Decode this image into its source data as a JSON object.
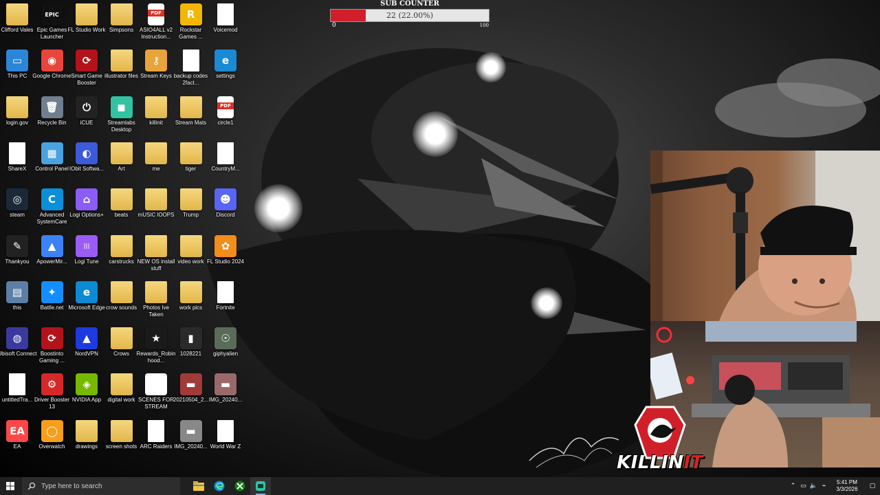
{
  "desktop": {
    "icons": [
      {
        "label": "Clifford Vales",
        "glyph": "",
        "kind": "folder",
        "color": "#e2b64a"
      },
      {
        "label": "Epic Games Launcher",
        "glyph": "EPIC",
        "kind": "app",
        "color": "#111111"
      },
      {
        "label": "FL Studio Work",
        "glyph": "",
        "kind": "folder",
        "color": "#e2b64a"
      },
      {
        "label": "Simpsons",
        "glyph": "",
        "kind": "folder",
        "color": "#e2b64a"
      },
      {
        "label": "ASIO4ALL v2 Instruction...",
        "glyph": "",
        "kind": "pdf",
        "color": "#d93025"
      },
      {
        "label": "Rockstar Games ...",
        "glyph": "R",
        "kind": "app",
        "color": "#f2b705"
      },
      {
        "label": "Voicemod",
        "glyph": "",
        "kind": "file",
        "color": "#ffffff"
      },
      {
        "label": "This PC",
        "glyph": "▭",
        "kind": "app",
        "color": "#2b86d9"
      },
      {
        "label": "Google Chrome",
        "glyph": "◉",
        "kind": "app",
        "color": "#e8453c"
      },
      {
        "label": "Smart Game Booster",
        "glyph": "⟳",
        "kind": "app",
        "color": "#b3121a"
      },
      {
        "label": "illustrator files",
        "glyph": "",
        "kind": "folder",
        "color": "#e2b64a"
      },
      {
        "label": "Stream Keys",
        "glyph": "⚷",
        "kind": "app",
        "color": "#e8a33a"
      },
      {
        "label": "backup codes 2fact...",
        "glyph": "",
        "kind": "file",
        "color": "#ffffff"
      },
      {
        "label": "settings",
        "glyph": "e",
        "kind": "app",
        "color": "#1a8ad4"
      },
      {
        "label": "login.gov",
        "glyph": "",
        "kind": "folder",
        "color": "#e2b64a"
      },
      {
        "label": "Recycle Bin",
        "glyph": "🗑",
        "kind": "app",
        "color": "#6f7f8f"
      },
      {
        "label": "iCUE",
        "glyph": "⏻",
        "kind": "app",
        "color": "#222222"
      },
      {
        "label": "Streamlabs Desktop",
        "glyph": "◼",
        "kind": "app",
        "color": "#31c3a2"
      },
      {
        "label": "killinit",
        "glyph": "",
        "kind": "folder",
        "color": "#e2b64a"
      },
      {
        "label": "Stream Mats",
        "glyph": "",
        "kind": "folder",
        "color": "#e2b64a"
      },
      {
        "label": "circle1",
        "glyph": "",
        "kind": "pdf",
        "color": "#d93025"
      },
      {
        "label": "ShareX",
        "glyph": "",
        "kind": "file",
        "color": "#ffffff"
      },
      {
        "label": "Control Panel",
        "glyph": "▦",
        "kind": "app",
        "color": "#4aa3df"
      },
      {
        "label": "IObit Softwa...",
        "glyph": "◐",
        "kind": "app",
        "color": "#3d5ad8"
      },
      {
        "label": "Art",
        "glyph": "",
        "kind": "folder",
        "color": "#e2b64a"
      },
      {
        "label": "me",
        "glyph": "",
        "kind": "folder",
        "color": "#e2b64a"
      },
      {
        "label": "tiger",
        "glyph": "",
        "kind": "folder",
        "color": "#e2b64a"
      },
      {
        "label": "CountryM...",
        "glyph": "",
        "kind": "file",
        "color": "#ffffff"
      },
      {
        "label": "steam",
        "glyph": "◎",
        "kind": "app",
        "color": "#1b2838"
      },
      {
        "label": "Advanced SystemCare",
        "glyph": "C",
        "kind": "app",
        "color": "#0a8fd9"
      },
      {
        "label": "Logi Options+",
        "glyph": "⌂",
        "kind": "app",
        "color": "#8b5cf6"
      },
      {
        "label": "beats",
        "glyph": "",
        "kind": "folder",
        "color": "#e2b64a"
      },
      {
        "label": "mUSIC lOOPS",
        "glyph": "",
        "kind": "folder",
        "color": "#e2b64a"
      },
      {
        "label": "Trump",
        "glyph": "",
        "kind": "folder",
        "color": "#e2b64a"
      },
      {
        "label": "Discord",
        "glyph": "☻",
        "kind": "app",
        "color": "#5865f2"
      },
      {
        "label": "Thankyou",
        "glyph": "✎",
        "kind": "app",
        "color": "#222222"
      },
      {
        "label": "ApowerMir...",
        "glyph": "▲",
        "kind": "app",
        "color": "#3b82f6"
      },
      {
        "label": "Logi Tune",
        "glyph": "|||",
        "kind": "app",
        "color": "#9b5cf6"
      },
      {
        "label": "carstrucks",
        "glyph": "",
        "kind": "folder",
        "color": "#e2b64a"
      },
      {
        "label": "NEW OS install stuff",
        "glyph": "",
        "kind": "folder",
        "color": "#e2b64a"
      },
      {
        "label": "video work",
        "glyph": "",
        "kind": "folder",
        "color": "#e2b64a"
      },
      {
        "label": "FL Studio 2024",
        "glyph": "✿",
        "kind": "app",
        "color": "#f28c1b"
      },
      {
        "label": "this",
        "glyph": "▤",
        "kind": "app",
        "color": "#5b7fa6"
      },
      {
        "label": "Battle.net",
        "glyph": "✦",
        "kind": "app",
        "color": "#148eff"
      },
      {
        "label": "Microsoft Edge",
        "glyph": "e",
        "kind": "app",
        "color": "#0c8ad3"
      },
      {
        "label": "crow sounds",
        "glyph": "",
        "kind": "folder",
        "color": "#e2b64a"
      },
      {
        "label": "Photos Ive Taken",
        "glyph": "",
        "kind": "folder",
        "color": "#e2b64a"
      },
      {
        "label": "work pics",
        "glyph": "",
        "kind": "folder",
        "color": "#e2b64a"
      },
      {
        "label": "Fortnite",
        "glyph": "",
        "kind": "file",
        "color": "#ffffff"
      },
      {
        "label": "Ubisoft Connect",
        "glyph": "◍",
        "kind": "app",
        "color": "#3a3a9e"
      },
      {
        "label": "Boostinto Gaming ...",
        "glyph": "⟳",
        "kind": "app",
        "color": "#b3121a"
      },
      {
        "label": "NordVPN",
        "glyph": "▲",
        "kind": "app",
        "color": "#1c3ae0"
      },
      {
        "label": "Crows",
        "glyph": "",
        "kind": "folder",
        "color": "#e2b64a"
      },
      {
        "label": "Rewards_Robinhood...",
        "glyph": "★",
        "kind": "app",
        "color": "#1a1a1a"
      },
      {
        "label": "1028221",
        "glyph": "▮",
        "kind": "app",
        "color": "#2a2a2a"
      },
      {
        "label": "giphyalien",
        "glyph": "☉",
        "kind": "app",
        "color": "#5a6b5a"
      },
      {
        "label": "untitledTra...",
        "glyph": "▶",
        "kind": "file",
        "color": "#ffffff"
      },
      {
        "label": "Driver Booster 13",
        "glyph": "⚙",
        "kind": "app",
        "color": "#d62828"
      },
      {
        "label": "NVIDIA App",
        "glyph": "◈",
        "kind": "app",
        "color": "#76b900"
      },
      {
        "label": "digital work",
        "glyph": "",
        "kind": "folder",
        "color": "#e2b64a"
      },
      {
        "label": "SCENES FOR STREAM",
        "glyph": "▦",
        "kind": "app",
        "color": "#ffffff"
      },
      {
        "label": "20210504_2...",
        "glyph": "▬",
        "kind": "app",
        "color": "#a33a3a"
      },
      {
        "label": "IMG_20240...",
        "glyph": "▬",
        "kind": "app",
        "color": "#9a6a6a"
      },
      {
        "label": "EA",
        "glyph": "EA",
        "kind": "app",
        "color": "#ff4747"
      },
      {
        "label": "Overwatch",
        "glyph": "◯",
        "kind": "app",
        "color": "#f99e1a"
      },
      {
        "label": "drawings",
        "glyph": "",
        "kind": "folder",
        "color": "#e2b64a"
      },
      {
        "label": "screen shots",
        "glyph": "",
        "kind": "folder",
        "color": "#e2b64a"
      },
      {
        "label": "ARC Raiders",
        "glyph": "",
        "kind": "file",
        "color": "#ffffff"
      },
      {
        "label": "IMG_20240...",
        "glyph": "▬",
        "kind": "app",
        "color": "#888888"
      },
      {
        "label": "World War Z",
        "glyph": "",
        "kind": "file",
        "color": "#ffffff"
      }
    ]
  },
  "sub_counter": {
    "title": "SUB COUNTER",
    "value_text": "22 (22.00%)",
    "progress": 0.22,
    "min": "0",
    "max": "100",
    "fill_color": "#d11f2a"
  },
  "stream_logo": {
    "text_white": "KILLIN",
    "text_red": "IT",
    "badge_color": "#d11f2a"
  },
  "taskbar": {
    "search_placeholder": "Type here to search",
    "pinned": [
      {
        "name": "file-explorer-icon",
        "color": "#f5c542"
      },
      {
        "name": "edge-icon",
        "color": "#0c8ad3"
      },
      {
        "name": "xbox-icon",
        "color": "#107c10"
      },
      {
        "name": "streamlabs-icon",
        "color": "#31c3a2"
      }
    ],
    "clock_time": "5:41 PM",
    "clock_date": "3/3/2026"
  }
}
